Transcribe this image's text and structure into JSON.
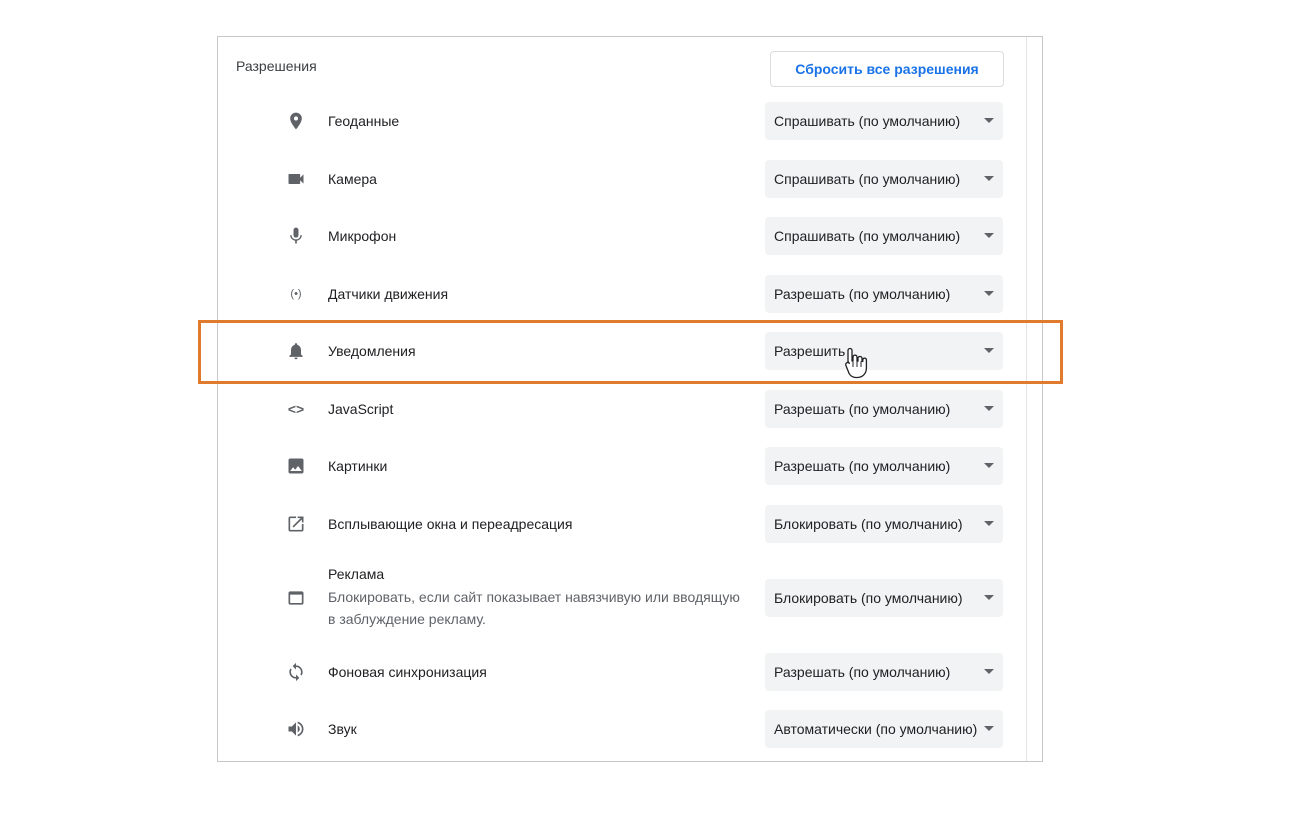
{
  "section": {
    "title": "Разрешения",
    "reset_label": "Сбросить все разрешения"
  },
  "permissions": [
    {
      "icon": "location-pin-icon",
      "label": "Геоданные",
      "value": "Спрашивать (по умолчанию)"
    },
    {
      "icon": "camera-icon",
      "label": "Камера",
      "value": "Спрашивать (по умолчанию)"
    },
    {
      "icon": "microphone-icon",
      "label": "Микрофон",
      "value": "Спрашивать (по умолчанию)"
    },
    {
      "icon": "motion-sensor-icon",
      "label": "Датчики движения",
      "value": "Разрешать (по умолчанию)"
    },
    {
      "icon": "bell-icon",
      "label": "Уведомления",
      "value": "Разрешить"
    },
    {
      "icon": "code-icon",
      "label": "JavaScript",
      "value": "Разрешать (по умолчанию)"
    },
    {
      "icon": "image-icon",
      "label": "Картинки",
      "value": "Разрешать (по умолчанию)"
    },
    {
      "icon": "popup-icon",
      "label": "Всплывающие окна и переадресация",
      "value": "Блокировать (по умолчанию)"
    },
    {
      "icon": "ads-icon",
      "label": "Реклама",
      "sub": "Блокировать, если сайт показывает навязчивую или вводящую в заблуждение рекламу.",
      "value": "Блокировать (по умолчанию)"
    },
    {
      "icon": "sync-icon",
      "label": "Фоновая синхронизация",
      "value": "Разрешать (по умолчанию)"
    },
    {
      "icon": "speaker-icon",
      "label": "Звук",
      "value": "Автоматически (по умолчанию)"
    }
  ],
  "colors": {
    "accent": "#1a73e8",
    "highlight": "#e07b2e",
    "select_bg": "#f1f3f4"
  }
}
